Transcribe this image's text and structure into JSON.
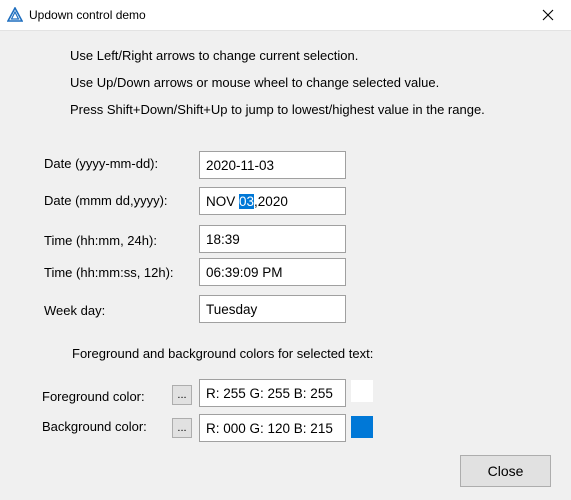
{
  "window": {
    "title": "Updown control demo",
    "app_icon": "triangle-logo-icon",
    "close_icon": "close-icon"
  },
  "instructions": [
    "Use Left/Right arrows to change current selection.",
    "Use Up/Down arrows or mouse wheel to change selected value.",
    "Press Shift+Down/Shift+Up to jump to lowest/highest value in the range."
  ],
  "fields": {
    "date_iso": {
      "label": "Date (yyyy-mm-dd):",
      "value": "2020-11-03"
    },
    "date_long": {
      "label": "Date (mmm dd,yyyy):",
      "value_pre": "NOV ",
      "value_sel": "03",
      "value_post": ",2020"
    },
    "time_24": {
      "label": "Time (hh:mm, 24h):",
      "value": "18:39"
    },
    "time_12": {
      "label": "Time (hh:mm:ss, 12h):",
      "value": "06:39:09 PM"
    },
    "week_day": {
      "label": "Week day:",
      "value": "Tuesday"
    }
  },
  "colors_section": {
    "heading": "Foreground and background colors for selected text:",
    "foreground": {
      "label": "Foreground color:",
      "button": "...",
      "value": "R: 255 G: 255 B: 255",
      "swatch": "#ffffff"
    },
    "background": {
      "label": "Background color:",
      "button": "...",
      "value": "R: 000 G: 120 B: 215",
      "swatch": "#0078d7"
    }
  },
  "buttons": {
    "close": "Close"
  }
}
